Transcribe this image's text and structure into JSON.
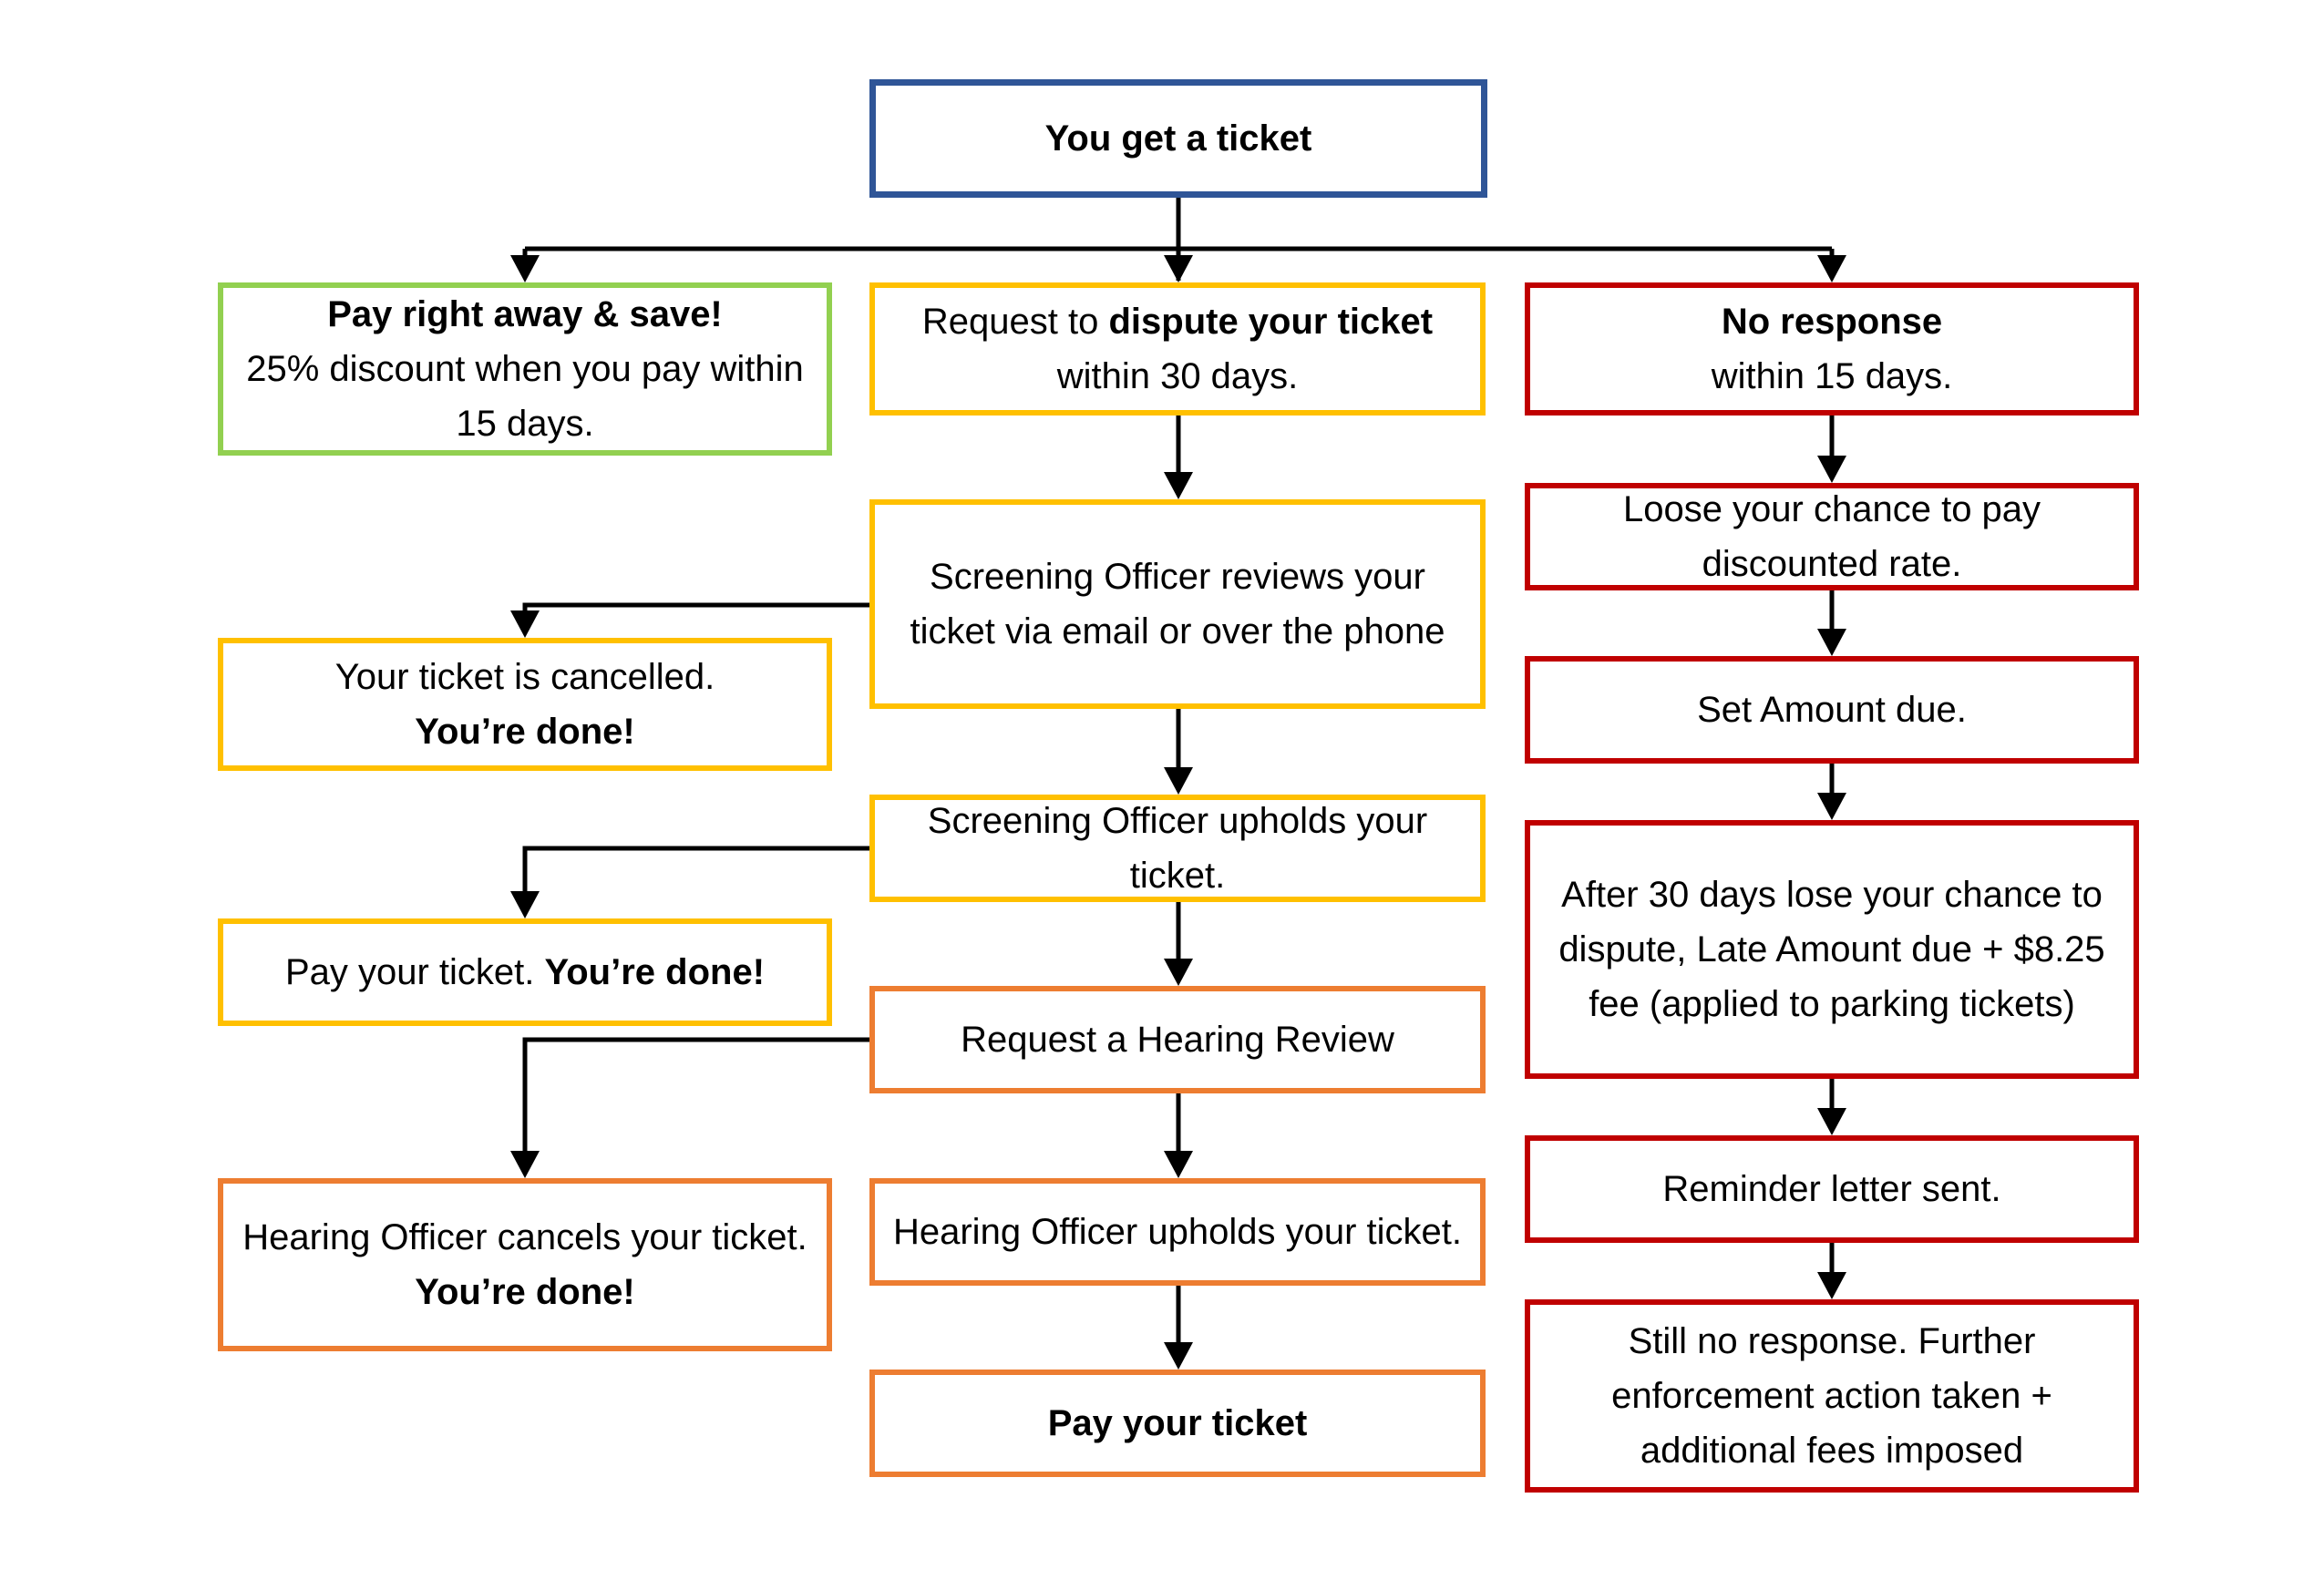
{
  "diagram": {
    "colors": {
      "start": "#2f5597",
      "pay_now": "#92d050",
      "dispute_screening": "#ffc000",
      "hearing": "#ed7d31",
      "no_response": "#c00000",
      "connector": "#000000"
    },
    "nodes": {
      "start": {
        "bold": "You get a ticket",
        "text": ""
      },
      "pay_now": {
        "bold": "Pay right away & save!",
        "text": "25% discount when you pay within 15 days."
      },
      "dispute": {
        "pre": "Request to ",
        "bold": "dispute your ticket",
        "text": "within 30 days."
      },
      "no_response": {
        "bold": "No response",
        "text": "within 15 days."
      },
      "screening_review": {
        "text": "Screening Officer reviews your ticket via email or over the phone"
      },
      "cancelled": {
        "text": "Your ticket is cancelled.",
        "bold": "You’re done!"
      },
      "lose_discount": {
        "text": "Loose your chance to pay discounted rate."
      },
      "set_amount": {
        "text": "Set Amount due."
      },
      "screening_upholds": {
        "text": "Screening Officer upholds your ticket."
      },
      "pay_done": {
        "text": "Pay your ticket. ",
        "bold": "You’re done!"
      },
      "late_amount": {
        "text": "After 30 days lose your chance to dispute, Late Amount due + $8.25 fee (applied to parking tickets)"
      },
      "hearing_request": {
        "text": "Request a Hearing Review"
      },
      "hearing_cancels": {
        "text": "Hearing Officer cancels your ticket. ",
        "bold": "You’re done!"
      },
      "reminder": {
        "text": "Reminder letter sent."
      },
      "hearing_upholds": {
        "text": "Hearing Officer upholds your ticket."
      },
      "pay_ticket": {
        "bold": "Pay your ticket"
      },
      "enforcement": {
        "text": "Still no response. Further enforcement action taken + additional fees imposed"
      }
    }
  }
}
